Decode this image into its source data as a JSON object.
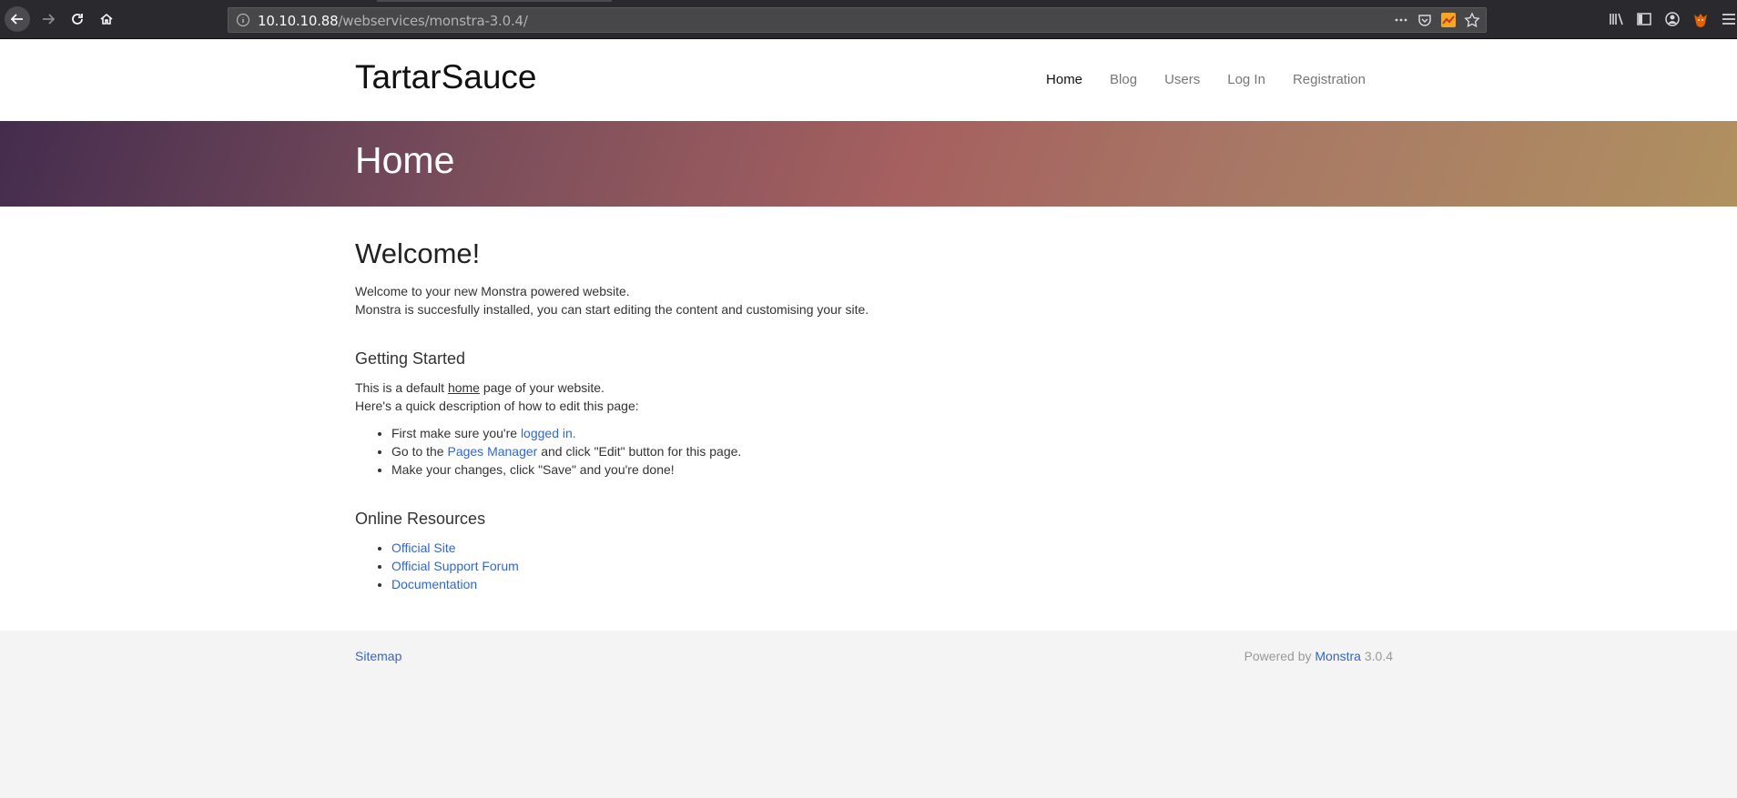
{
  "browser": {
    "url_host": "10.10.10.88",
    "url_path": "/webservices/monstra-3.0.4/"
  },
  "site": {
    "brand": "TartarSauce",
    "nav": [
      {
        "label": "Home"
      },
      {
        "label": "Blog"
      },
      {
        "label": "Users"
      },
      {
        "label": "Log In"
      },
      {
        "label": "Registration"
      }
    ],
    "hero_title": "Home"
  },
  "content": {
    "heading": "Welcome!",
    "intro_line1": "Welcome to your new Monstra powered website.",
    "intro_line2": "Monstra is succesfully installed, you can start editing the content and customising your site.",
    "getting_started": {
      "title": "Getting Started",
      "line1_pre": "This is a default ",
      "line1_link": "home",
      "line1_post": " page of your website.",
      "line2": "Here's a quick description of how to edit this page:",
      "step1_pre": "First make sure you're ",
      "step1_link": "logged in.",
      "step2_pre": "Go to the ",
      "step2_link": "Pages Manager",
      "step2_post": " and click \"Edit\" button for this page.",
      "step3": "Make your changes, click \"Save\" and you're done!"
    },
    "resources": {
      "title": "Online Resources",
      "links": [
        "Official Site",
        "Official Support Forum",
        "Documentation"
      ]
    }
  },
  "footer": {
    "sitemap": "Sitemap",
    "powered_pre": "Powered by ",
    "powered_link": "Monstra",
    "powered_post": " 3.0.4"
  },
  "colors": {
    "link": "#3366cc",
    "toolbar": "#2a2a2e",
    "footer_bg": "#f4f4f4"
  }
}
